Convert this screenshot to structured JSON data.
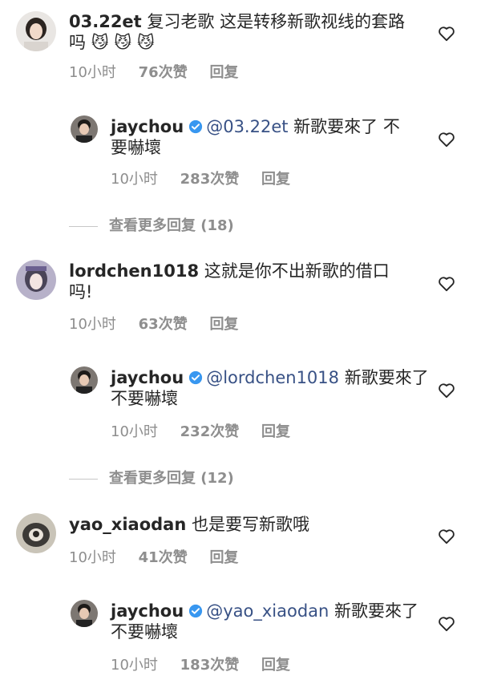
{
  "comments": [
    {
      "username": "03.22et",
      "text": "复习老歌 这是转移新歌视线的套路吗",
      "emoji": "😼 😼 😼",
      "time": "10小时",
      "likes": "76次赞",
      "reply": "回复",
      "reply_comment": {
        "username": "jaychou",
        "mention": "@03.22et",
        "text": "新歌要來了 不要嚇壞",
        "time": "10小时",
        "likes": "283次赞",
        "reply": "回复"
      },
      "more_replies": "查看更多回复 (18)"
    },
    {
      "username": "lordchen1018",
      "text": "这就是你不出新歌的借口吗!",
      "time": "10小时",
      "likes": "63次赞",
      "reply": "回复",
      "reply_comment": {
        "username": "jaychou",
        "mention": "@lordchen1018",
        "text": "新歌要來了 不要嚇壞",
        "time": "10小时",
        "likes": "232次赞",
        "reply": "回复"
      },
      "more_replies": "查看更多回复 (12)"
    },
    {
      "username": "yao_xiaodan",
      "text": "也是要写新歌哦",
      "time": "10小时",
      "likes": "41次赞",
      "reply": "回复",
      "reply_comment": {
        "username": "jaychou",
        "mention": "@yao_xiaodan",
        "text": "新歌要來了 不要嚇壞",
        "time": "10小时",
        "likes": "183次赞",
        "reply": "回复"
      }
    }
  ],
  "colors": {
    "verified": "#3897f0",
    "mention": "#385185",
    "meta": "#8e8e8e"
  }
}
